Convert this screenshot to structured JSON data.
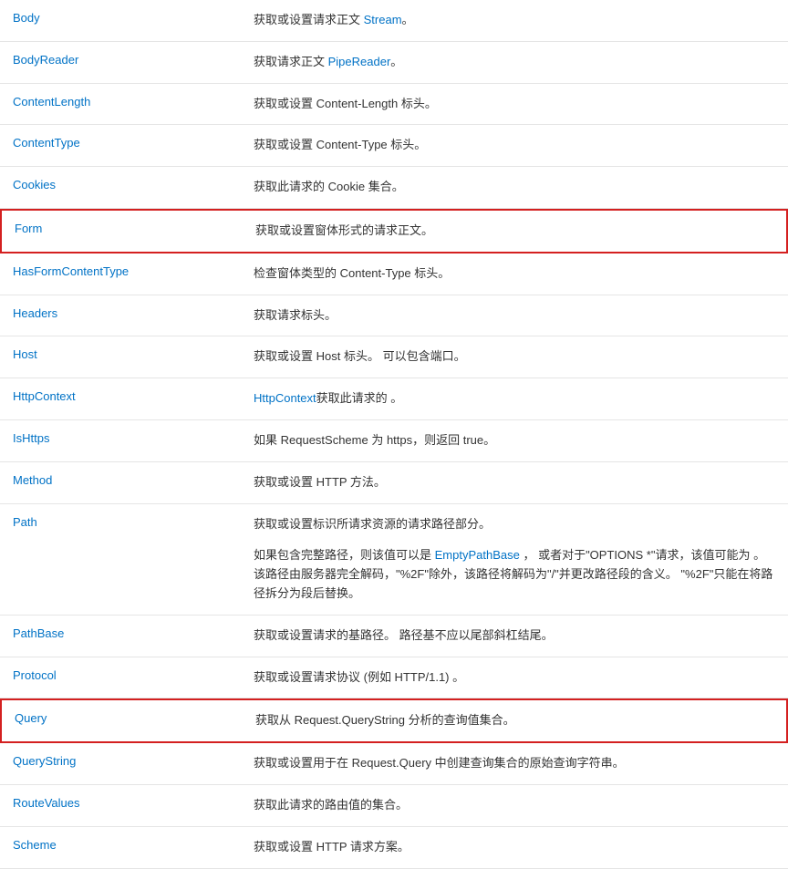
{
  "rows": [
    {
      "name": "Body",
      "highlight": false,
      "desc": [
        {
          "segments": [
            {
              "t": "获取或设置请求正文 "
            },
            {
              "t": "Stream",
              "link": true
            },
            {
              "t": "。"
            }
          ]
        }
      ]
    },
    {
      "name": "BodyReader",
      "highlight": false,
      "desc": [
        {
          "segments": [
            {
              "t": "获取请求正文 "
            },
            {
              "t": "PipeReader",
              "link": true
            },
            {
              "t": "。"
            }
          ]
        }
      ]
    },
    {
      "name": "ContentLength",
      "highlight": false,
      "desc": [
        {
          "segments": [
            {
              "t": "获取或设置 Content-Length 标头。"
            }
          ]
        }
      ]
    },
    {
      "name": "ContentType",
      "highlight": false,
      "desc": [
        {
          "segments": [
            {
              "t": "获取或设置 Content-Type 标头。"
            }
          ]
        }
      ]
    },
    {
      "name": "Cookies",
      "highlight": false,
      "desc": [
        {
          "segments": [
            {
              "t": "获取此请求的 Cookie 集合。"
            }
          ]
        }
      ]
    },
    {
      "name": "Form",
      "highlight": true,
      "desc": [
        {
          "segments": [
            {
              "t": "获取或设置窗体形式的请求正文。"
            }
          ]
        }
      ]
    },
    {
      "name": "HasFormContentType",
      "highlight": false,
      "desc": [
        {
          "segments": [
            {
              "t": "检查窗体类型的 Content-Type 标头。"
            }
          ]
        }
      ]
    },
    {
      "name": "Headers",
      "highlight": false,
      "desc": [
        {
          "segments": [
            {
              "t": "获取请求标头。"
            }
          ]
        }
      ]
    },
    {
      "name": "Host",
      "highlight": false,
      "desc": [
        {
          "segments": [
            {
              "t": "获取或设置 Host 标头。 可以包含端口。"
            }
          ]
        }
      ]
    },
    {
      "name": "HttpContext",
      "highlight": false,
      "desc": [
        {
          "segments": [
            {
              "t": "HttpContext",
              "link": true
            },
            {
              "t": "获取此请求的 。"
            }
          ]
        }
      ]
    },
    {
      "name": "IsHttps",
      "highlight": false,
      "desc": [
        {
          "segments": [
            {
              "t": "如果 RequestScheme 为 https，则返回 true。"
            }
          ]
        }
      ]
    },
    {
      "name": "Method",
      "highlight": false,
      "desc": [
        {
          "segments": [
            {
              "t": "获取或设置 HTTP 方法。"
            }
          ]
        }
      ]
    },
    {
      "name": "Path",
      "highlight": false,
      "desc": [
        {
          "segments": [
            {
              "t": "获取或设置标识所请求资源的请求路径部分。"
            }
          ]
        },
        {
          "segments": [
            {
              "t": "如果包含完整路径，则该值可以是 "
            },
            {
              "t": "Empty",
              "link": true
            },
            {
              "t": "PathBase",
              "link": true
            },
            {
              "t": " ， 或者对于\"OPTIONS *\"请求，该值可能为 。 该路径由服务器完全解码，\"%2F\"除外，该路径将解码为\"/\"并更改路径段的含义。 \"%2F\"只能在将路径拆分为段后替换。"
            }
          ]
        }
      ]
    },
    {
      "name": "PathBase",
      "highlight": false,
      "desc": [
        {
          "segments": [
            {
              "t": "获取或设置请求的基路径。 路径基不应以尾部斜杠结尾。"
            }
          ]
        }
      ]
    },
    {
      "name": "Protocol",
      "highlight": false,
      "desc": [
        {
          "segments": [
            {
              "t": "获取或设置请求协议 (例如 HTTP/1.1) 。"
            }
          ]
        }
      ]
    },
    {
      "name": "Query",
      "highlight": true,
      "desc": [
        {
          "segments": [
            {
              "t": "获取从 Request.QueryString 分析的查询值集合。"
            }
          ]
        }
      ]
    },
    {
      "name": "QueryString",
      "highlight": false,
      "desc": [
        {
          "segments": [
            {
              "t": "获取或设置用于在 Request.Query 中创建查询集合的原始查询字符串。"
            }
          ]
        }
      ]
    },
    {
      "name": "RouteValues",
      "highlight": false,
      "desc": [
        {
          "segments": [
            {
              "t": "获取此请求的路由值的集合。"
            }
          ]
        }
      ]
    },
    {
      "name": "Scheme",
      "highlight": false,
      "desc": [
        {
          "segments": [
            {
              "t": "获取或设置 HTTP 请求方案。"
            }
          ]
        }
      ]
    }
  ]
}
